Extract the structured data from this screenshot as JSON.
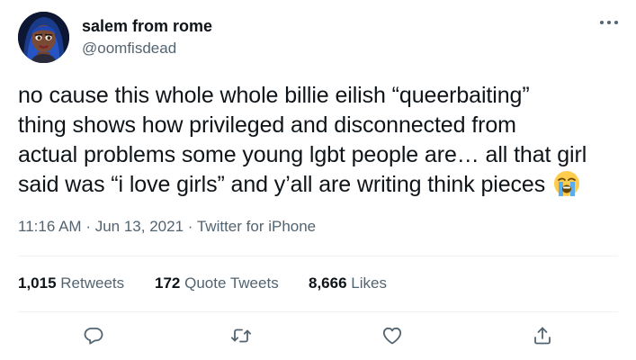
{
  "user": {
    "display_name": "salem from rome",
    "handle": "@oomfisdead",
    "avatar_icon": "avatar-cartoon-girl"
  },
  "tweet": {
    "lines": [
      "no cause this whole whole billie eilish “queerbaiting”",
      "thing shows how privileged and disconnected from",
      "actual problems some young lgbt people are… all that girl",
      "said was “i love girls” and y’all are writing think pieces"
    ],
    "emoji": "loudly-crying-face"
  },
  "meta": {
    "time": "11:16 AM",
    "sep1": "·",
    "date": "Jun 13, 2021",
    "sep2": "·",
    "source": "Twitter for iPhone"
  },
  "stats": {
    "retweets": {
      "count": "1,015",
      "label": "Retweets"
    },
    "quotes": {
      "count": "172",
      "label": "Quote Tweets"
    },
    "likes": {
      "count": "8,666",
      "label": "Likes"
    }
  },
  "actions": [
    "reply-icon",
    "retweet-icon",
    "like-icon",
    "share-icon"
  ],
  "colors": {
    "text": "#0f1419",
    "secondary": "#536471",
    "divider": "#eff3f4"
  }
}
